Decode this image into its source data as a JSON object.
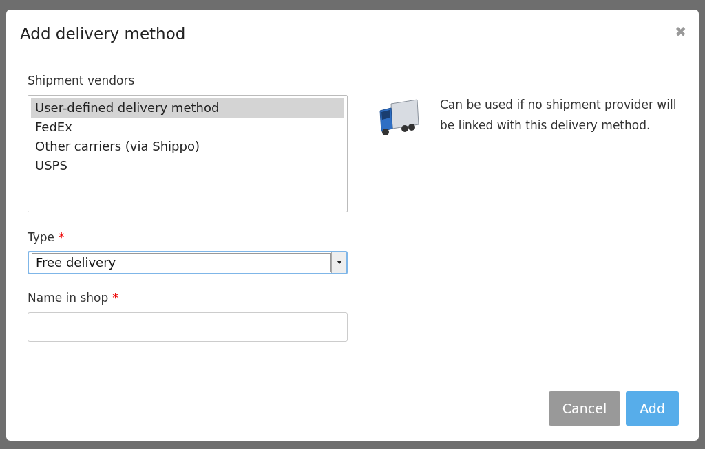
{
  "dialog": {
    "title": "Add delivery method",
    "close": "✖"
  },
  "vendors": {
    "label": "Shipment vendors",
    "items": [
      {
        "label": "User-defined delivery method",
        "selected": true
      },
      {
        "label": "FedEx",
        "selected": false
      },
      {
        "label": "Other carriers (via Shippo)",
        "selected": false
      },
      {
        "label": "USPS",
        "selected": false
      }
    ]
  },
  "type": {
    "label": "Type",
    "required_mark": "*",
    "value": "Free delivery"
  },
  "name_in_shop": {
    "label": "Name in shop",
    "required_mark": "*"
  },
  "info": "Can be used if no shipment provider will be linked with this delivery method.",
  "buttons": [
    {
      "label": "Cancel",
      "kind": "secondary"
    },
    {
      "label": "Add",
      "kind": "primary"
    }
  ]
}
